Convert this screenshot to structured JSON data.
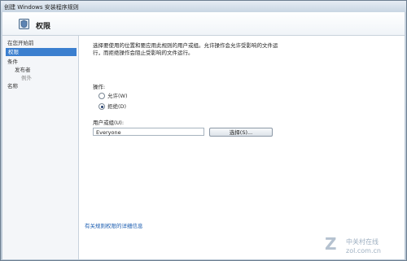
{
  "window": {
    "title": "创建 Windows 安装程序规则"
  },
  "header": {
    "title": "权限",
    "icon": "shield-icon"
  },
  "sidebar": {
    "items": [
      {
        "label": "在您开始前",
        "selected": false
      },
      {
        "label": "权限",
        "selected": true
      },
      {
        "label": "条件",
        "selected": false
      },
      {
        "label": "发布者",
        "selected": false
      },
      {
        "label": "例外",
        "selected": false
      },
      {
        "label": "名称",
        "selected": false
      }
    ]
  },
  "content": {
    "description_line1": "选择要使用的位置和要应用此规则的用户或组。允许操作会允许受影响的文件运",
    "description_line2": "行，而拒绝操作会阻止受影响的文件运行。",
    "action_label": "操作:",
    "options": [
      {
        "label": "允许(W)",
        "checked": false
      },
      {
        "label": "拒绝(D)",
        "checked": true
      }
    ],
    "user_label": "用户或组(U):",
    "user_value": "Everyone",
    "select_button": "选择(S)...",
    "help_link": "有关规则权限的详细信息"
  },
  "watermark": {
    "brand": "中关村在线",
    "url": "zol.com.cn"
  }
}
